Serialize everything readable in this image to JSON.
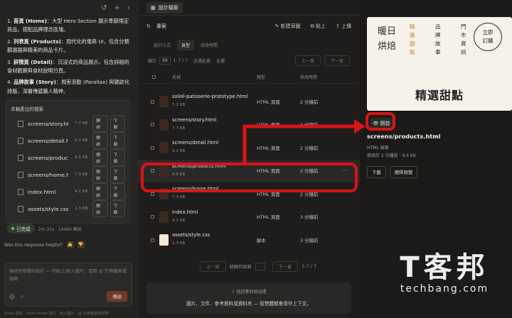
{
  "chat": {
    "list": [
      {
        "title": "首頁 (Home)",
        "text": "：大型 Hero Section 展示季節限定商品，搭配品牌理念區塊。"
      },
      {
        "title": "列表頁 (Products)",
        "text": "：現代化的電商 UI，包含分類篩選器與精美的商品卡片。"
      },
      {
        "title": "詳情頁 (Detail)",
        "text": "：沉浸式的商品展示，包含詳細的食材觀察與食材說明分頁。"
      },
      {
        "title": "品牌故事 (Story)",
        "text": "：視差滾動 (Parallax) 與雜誌化排版，深層傳遞職人精神。"
      }
    ],
    "files_title": "本輪產出的檔案",
    "files": [
      {
        "name": "screens/story.html",
        "size": "7.7 KB"
      },
      {
        "name": "screens/detail.html",
        "size": "9.2 KB"
      },
      {
        "name": "screens/products.html",
        "size": "9.6 KB"
      },
      {
        "name": "screens/home.html",
        "size": "7.3 KB"
      },
      {
        "name": "index.html",
        "size": "4.1 KB"
      },
      {
        "name": "assets/style.css",
        "size": "2.3 KB"
      }
    ],
    "open_label": "開啟",
    "download_label": "下載",
    "done_label": "已完成",
    "done_meta": "2m 31s · 14490 輸出",
    "helpful_label": "Was this response helpful?",
    "composer_placeholder": "描述你想要的設計 — 可貼上/拖入圖片，或用 @ 引用檔案或說明",
    "send_label": "傳送",
    "footer_note": "Enter 送出 · Shift+Enter 換行 · 拖入圖片 · @ 引用檔案或說明"
  },
  "mid": {
    "tab_label": "設計檔案",
    "project_label": "專案",
    "actions": [
      "新建草圖",
      "貼上",
      "上傳"
    ],
    "filters": [
      "設計方式",
      "頁型",
      "修改時間"
    ],
    "paging": {
      "prefix": "顯示",
      "size": "50",
      "range": "1–7 / 7",
      "sel_page": "全選此頁",
      "sel_all": "全選",
      "prev": "上一頁",
      "next": "下一頁"
    },
    "columns": [
      "名稱",
      "類型",
      "修改時間"
    ],
    "rows": [
      {
        "name": "soleil-patisserie-prototype.html",
        "size": "5.2 KB",
        "type": "HTML 頁面",
        "time": "2 分鐘前"
      },
      {
        "name": "screens/story.html",
        "size": "7.7 KB",
        "type": "HTML 頁面",
        "time": "2 分鐘前"
      },
      {
        "name": "screens/detail.html",
        "size": "9.2 KB",
        "type": "HTML 頁面",
        "time": "2 分鐘前"
      },
      {
        "name": "screens/products.html",
        "size": "9.6 KB",
        "type": "HTML 頁面",
        "time": "2 分鐘前"
      },
      {
        "name": "screens/home.html",
        "size": "7.3 KB",
        "type": "HTML 頁面",
        "time": "2 分鐘前"
      },
      {
        "name": "index.html",
        "size": "4.1 KB",
        "type": "HTML 頁面",
        "time": "3 分鐘前"
      },
      {
        "name": "assets/style.css",
        "size": "2.3 KB",
        "type": "腳本",
        "time": "3 分鐘前"
      }
    ],
    "bottom_pager": {
      "prev": "上一頁",
      "jump": "跳轉到頁面",
      "next": "下一頁",
      "range": "1–7 / 7"
    },
    "drop_title": "拖放素材到這裡",
    "drop_text": "圖片、文件、參考資料或資料夾 — 智慧體都會用作上下文。"
  },
  "preview": {
    "brand": "暖日烘焙",
    "col_accent": "精選甜點",
    "col2": "品牌故事",
    "col3": "門市資訊",
    "cta": "立即訂購",
    "headline": "精選甜點",
    "open_label": "開啟",
    "file": "screens/products.html",
    "type": "HTML 頁面",
    "meta": "修改於 2 分鐘前 · 9.6 KB",
    "download": "下載",
    "share": "團隊預覽"
  },
  "watermark": {
    "big": "T客邦",
    "small": "techbang.com"
  },
  "colors": {
    "highlight": "#d8141a",
    "accent": "#c27b1b"
  }
}
